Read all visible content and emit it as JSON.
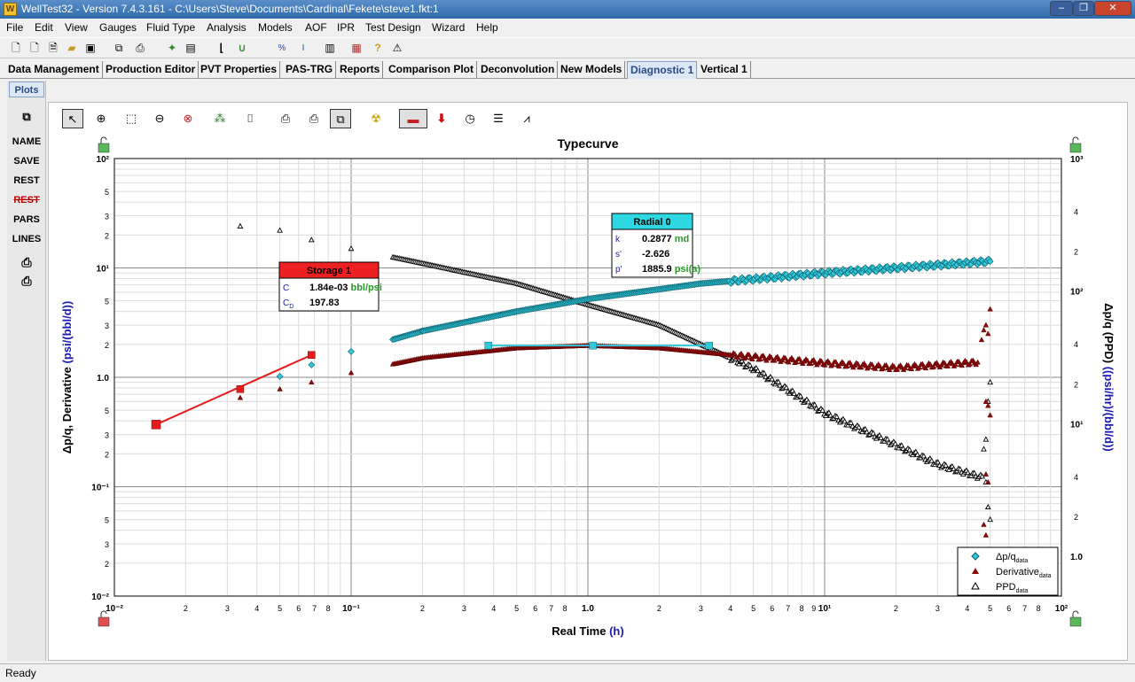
{
  "window": {
    "app_icon": "W",
    "title": "WellTest32 - Version 7.4.3.161 - C:\\Users\\Steve\\Documents\\Cardinal\\Fekete\\steve1.fkt:1",
    "buttons": [
      "–",
      "❐",
      "✕"
    ]
  },
  "menu": [
    "File",
    "Edit",
    "View",
    "Gauges",
    "Fluid Type",
    "Analysis",
    "Models",
    "AOF",
    "IPR",
    "Test Design",
    "Wizard",
    "Help"
  ],
  "toolbar_icons": [
    "new-file-icon",
    "new-doc-icon",
    "new-page-icon",
    "open-folder-icon",
    "save-icon",
    "copy-icon",
    "print-icon",
    "wizard-icon",
    "table-icon",
    "bracket-icon",
    "u-curve-icon",
    "ipr-p-icon",
    "ipr-r-icon",
    "notebook-icon",
    "chart-color-icon",
    "help-icon",
    "context-help-icon"
  ],
  "tabs": [
    "Data Management",
    "Production Editor",
    "PVT Properties",
    "PAS-TRG",
    "Reports",
    "Comparison Plot",
    "Deconvolution",
    "New Models",
    "Diagnostic 1",
    "Vertical 1"
  ],
  "active_tab": "Diagnostic 1",
  "sidebar": {
    "tab": "Plots",
    "buttons": [
      "NAME",
      "SAVE",
      "REST",
      "REST",
      "PARS",
      "LINES"
    ]
  },
  "plot_toolbar_icons": [
    "select-arrow-icon",
    "zoom-in-icon",
    "zoom-box-icon",
    "zoom-out-icon",
    "zoom-reset-icon",
    "scatter-icon",
    "eraser-icon",
    "print-plot-icon",
    "print-multi-icon",
    "copy-window-icon",
    "radiation-icon",
    "line-tool-icon",
    "arrow-down-icon",
    "clock-icon",
    "lines-icon",
    "graph-icon"
  ],
  "status_text": "Ready",
  "colors": {
    "cyan": "#31c9d8",
    "red": "#e41c1c",
    "axis_blue": "#1a1ab0"
  },
  "chart_data": {
    "type": "scatter",
    "title": "Typecurve",
    "xlabel_main": "Real Time ",
    "xlabel_unit": "(h)",
    "ylabel_left_main": "Δp/q, Derivative ",
    "ylabel_left_unit": "(psi/(bbl/d))",
    "ylabel_right_main": "Δp/q (PPD) ",
    "ylabel_right_unit": "((psi/hr)/(bbl/d))",
    "x_scale": "log",
    "xlim": [
      0.01,
      100
    ],
    "y_scale": "log",
    "ylim": [
      0.01,
      100
    ],
    "y2_scale": "log",
    "y2lim": [
      0.5,
      1000
    ],
    "x_decade_labels": [
      "10⁻²",
      "10⁻¹",
      "1.0",
      "10¹",
      "10²"
    ],
    "x_minor_labels": [
      "2",
      "3",
      "4",
      "5",
      "6",
      "7",
      "8",
      "9"
    ],
    "y_decade_labels": [
      "10⁻²",
      "10⁻¹",
      "1.0",
      "10¹",
      "10²"
    ],
    "y_minor_labels": [
      "2",
      "3",
      "5"
    ],
    "y2_major_labels": [
      "1.0",
      "10¹",
      "10²",
      "10³"
    ],
    "y2_minor_labels": [
      "2",
      "4"
    ],
    "grid": true,
    "legend_position": "bottom-right",
    "legend": [
      {
        "label": "Δp/q",
        "sub": "data"
      },
      {
        "label": "Derivative",
        "sub": "data"
      },
      {
        "label": "PPD",
        "sub": "data"
      }
    ],
    "storage_box": {
      "title": "Storage 1",
      "rows": [
        {
          "key": "C",
          "value": "1.84e-03",
          "unit": "bbl/psi"
        },
        {
          "key": "C",
          "sub": "D",
          "value": "197.83",
          "unit": ""
        }
      ]
    },
    "radial_box": {
      "title": "Radial 0",
      "rows": [
        {
          "key": "k",
          "value": "0.2877",
          "unit": "md"
        },
        {
          "key": "s'",
          "value": "-2.626",
          "unit": ""
        },
        {
          "key": "p'",
          "value": "1885.9",
          "unit": "psi(a)"
        }
      ]
    },
    "series": {
      "storage_line": {
        "x": [
          0.015,
          0.034,
          0.068
        ],
        "y": [
          0.37,
          0.78,
          1.6
        ]
      },
      "radial_line": {
        "x": [
          0.38,
          1.05,
          3.25
        ],
        "y": 1.95
      },
      "dpq_anchors": {
        "x": [
          0.05,
          0.068,
          0.1,
          0.2,
          0.5,
          1.0,
          3.0,
          10,
          50
        ],
        "y": [
          1.02,
          1.3,
          1.72,
          2.65,
          4.0,
          5.2,
          7.2,
          9.0,
          11.5
        ]
      },
      "deriv_anchors": {
        "x": [
          0.034,
          0.05,
          0.068,
          0.1,
          0.2,
          0.5,
          1.0,
          2.0,
          4.0,
          10,
          20,
          45
        ],
        "y": [
          0.65,
          0.78,
          0.9,
          1.1,
          1.5,
          1.85,
          1.95,
          1.85,
          1.6,
          1.35,
          1.22,
          1.38
        ]
      },
      "deriv_tail": {
        "x": [
          46,
          47,
          48,
          49,
          50,
          48,
          49,
          50,
          48,
          49,
          47,
          48
        ],
        "y": [
          2.2,
          2.7,
          3.0,
          2.5,
          4.2,
          0.6,
          0.55,
          0.45,
          0.13,
          0.11,
          0.045,
          0.036
        ]
      },
      "ppd_anchors": {
        "x": [
          0.034,
          0.05,
          0.068,
          0.1,
          0.2,
          0.5,
          1.0,
          2.0,
          5.0,
          10,
          20,
          30,
          47
        ],
        "y": [
          24,
          22,
          18,
          15,
          11,
          7.2,
          4.6,
          3.0,
          1.2,
          0.47,
          0.24,
          0.16,
          0.12
        ]
      },
      "ppd_tail": {
        "x": [
          47,
          48,
          49,
          50,
          48,
          49,
          50
        ],
        "y": [
          0.22,
          0.27,
          0.6,
          0.9,
          0.11,
          0.065,
          0.05
        ]
      }
    }
  }
}
